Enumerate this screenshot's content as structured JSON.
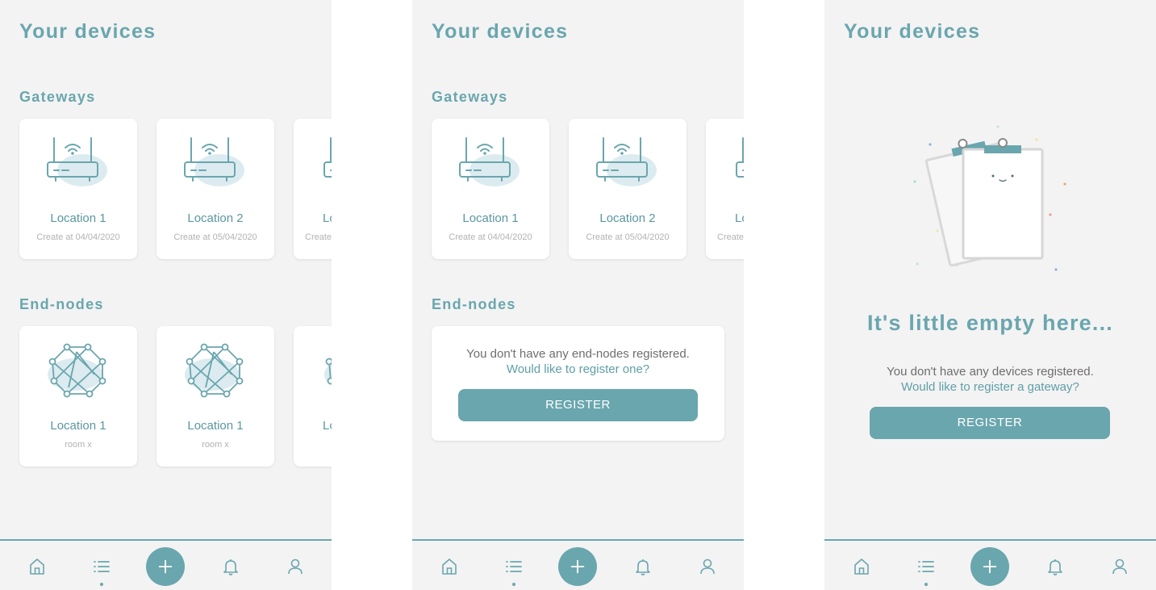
{
  "colors": {
    "accent": "#6aa6ae",
    "background": "#f3f3f3",
    "card": "#ffffff",
    "muted_text": "#b2b2b2",
    "body_text": "#6e6e6e"
  },
  "screen1": {
    "title": "Your devices",
    "gateways_title": "Gateways",
    "gateways": [
      {
        "name": "Location 1",
        "sub": "Create at 04/04/2020",
        "icon": "router-icon"
      },
      {
        "name": "Location 2",
        "sub": "Create at 05/04/2020",
        "icon": "router-icon"
      },
      {
        "name": "Lo",
        "sub": "Create",
        "icon": "router-icon"
      }
    ],
    "endnodes_title": "End-nodes",
    "endnodes": [
      {
        "name": "Location 1",
        "sub": "room x",
        "icon": "network-node-icon"
      },
      {
        "name": "Location 1",
        "sub": "room x",
        "icon": "network-node-icon"
      },
      {
        "name": "Lo",
        "sub": "",
        "icon": "network-node-icon"
      }
    ]
  },
  "screen2": {
    "title": "Your devices",
    "gateways_title": "Gateways",
    "gateways": [
      {
        "name": "Location 1",
        "sub": "Create at 04/04/2020",
        "icon": "router-icon"
      },
      {
        "name": "Location 2",
        "sub": "Create at 05/04/2020",
        "icon": "router-icon"
      },
      {
        "name": "Lo",
        "sub": "Create",
        "icon": "router-icon"
      }
    ],
    "endnodes_title": "End-nodes",
    "empty_message": "You don't have any end-nodes registered.",
    "empty_link": "Would like to register one?",
    "register_label": "REGISTER"
  },
  "screen3": {
    "title": "Your devices",
    "empty_heading": "It's little empty here...",
    "empty_message": "You don't have any devices registered.",
    "empty_link": "Would like to register a gateway?",
    "register_label": "REGISTER",
    "illustration": "empty-clipboard-illustration"
  },
  "tabbar": {
    "tabs": [
      {
        "icon": "home-icon"
      },
      {
        "icon": "list-icon",
        "active": true
      },
      {
        "icon": "plus-icon"
      },
      {
        "icon": "bell-icon"
      },
      {
        "icon": "user-icon"
      }
    ]
  }
}
